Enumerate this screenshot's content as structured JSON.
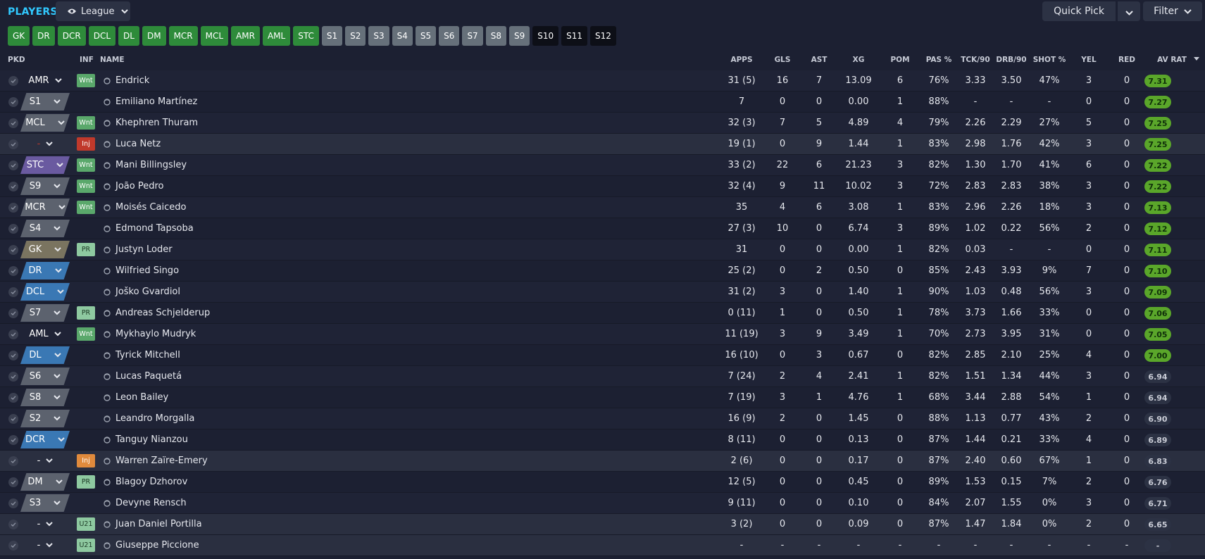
{
  "header": {
    "title": "PLAYERS",
    "view_label": "League",
    "quick_pick_label": "Quick Pick",
    "filter_label": "Filter"
  },
  "position_filters": [
    {
      "label": "GK",
      "style": "green"
    },
    {
      "label": "DR",
      "style": "green"
    },
    {
      "label": "DCR",
      "style": "green"
    },
    {
      "label": "DCL",
      "style": "green"
    },
    {
      "label": "DL",
      "style": "green"
    },
    {
      "label": "DM",
      "style": "green"
    },
    {
      "label": "MCR",
      "style": "green"
    },
    {
      "label": "MCL",
      "style": "green"
    },
    {
      "label": "AMR",
      "style": "green"
    },
    {
      "label": "AML",
      "style": "green"
    },
    {
      "label": "STC",
      "style": "green"
    },
    {
      "label": "S1",
      "style": "grey"
    },
    {
      "label": "S2",
      "style": "grey"
    },
    {
      "label": "S3",
      "style": "grey"
    },
    {
      "label": "S4",
      "style": "grey"
    },
    {
      "label": "S5",
      "style": "grey"
    },
    {
      "label": "S6",
      "style": "grey"
    },
    {
      "label": "S7",
      "style": "grey"
    },
    {
      "label": "S8",
      "style": "grey"
    },
    {
      "label": "S9",
      "style": "grey"
    },
    {
      "label": "S10",
      "style": "dark"
    },
    {
      "label": "S11",
      "style": "dark"
    },
    {
      "label": "S12",
      "style": "dark"
    }
  ],
  "columns": {
    "pkd": "PKD",
    "inf": "INF",
    "name": "NAME",
    "apps": "APPS",
    "gls": "GLS",
    "ast": "AST",
    "xg": "XG",
    "pom": "POM",
    "pas": "PAS %",
    "tck": "TCK/90",
    "drb": "DRB/90",
    "shot": "SHOT %",
    "yel": "YEL",
    "red": "RED",
    "avrat": "AV RAT"
  },
  "colors": {
    "accent_title": "#31c9ff",
    "pos_selected": "#1c2032",
    "pos_sub": "#5c626e",
    "pos_def": "#3a78b4",
    "pos_st": "#6a5aa0",
    "pos_gk": "#7a7460"
  },
  "players": [
    {
      "pos": "AMR",
      "pos_type": "sel",
      "inf": "Wnt",
      "name": "Endrick",
      "apps": "31 (5)",
      "gls": "16",
      "ast": "7",
      "xg": "13.09",
      "pom": "6",
      "pas": "76%",
      "tck": "3.33",
      "drb": "3.50",
      "shot": "47%",
      "yel": "3",
      "red": "0",
      "rat": "7.31",
      "hl": false
    },
    {
      "pos": "S1",
      "pos_type": "sub",
      "inf": "",
      "name": "Emiliano Martínez",
      "apps": "7",
      "gls": "0",
      "ast": "0",
      "xg": "0.00",
      "pom": "1",
      "pas": "88%",
      "tck": "-",
      "drb": "-",
      "shot": "-",
      "yel": "0",
      "red": "0",
      "rat": "7.27",
      "hl": false
    },
    {
      "pos": "MCL",
      "pos_type": "sub",
      "inf": "Wnt",
      "name": "Khephren Thuram",
      "apps": "32 (3)",
      "gls": "7",
      "ast": "5",
      "xg": "4.89",
      "pom": "4",
      "pas": "79%",
      "tck": "2.26",
      "drb": "2.29",
      "shot": "27%",
      "yel": "5",
      "red": "0",
      "rat": "7.25",
      "hl": false
    },
    {
      "pos": "-",
      "pos_type": "selred",
      "inf": "Inj",
      "name": "Luca Netz",
      "apps": "19 (1)",
      "gls": "0",
      "ast": "9",
      "xg": "1.44",
      "pom": "1",
      "pas": "83%",
      "tck": "2.98",
      "drb": "1.76",
      "shot": "42%",
      "yel": "3",
      "red": "0",
      "rat": "7.25",
      "hl": true
    },
    {
      "pos": "STC",
      "pos_type": "st",
      "inf": "Wnt",
      "name": "Mani Billingsley",
      "apps": "33 (2)",
      "gls": "22",
      "ast": "6",
      "xg": "21.23",
      "pom": "3",
      "pas": "82%",
      "tck": "1.30",
      "drb": "1.70",
      "shot": "41%",
      "yel": "6",
      "red": "0",
      "rat": "7.22",
      "hl": false
    },
    {
      "pos": "S9",
      "pos_type": "sub",
      "inf": "Wnt",
      "name": "João Pedro",
      "apps": "32 (4)",
      "gls": "9",
      "ast": "11",
      "xg": "10.02",
      "pom": "3",
      "pas": "72%",
      "tck": "2.83",
      "drb": "2.83",
      "shot": "38%",
      "yel": "3",
      "red": "0",
      "rat": "7.22",
      "hl": false
    },
    {
      "pos": "MCR",
      "pos_type": "sub",
      "inf": "Wnt",
      "name": "Moisés Caicedo",
      "apps": "35",
      "gls": "4",
      "ast": "6",
      "xg": "3.08",
      "pom": "1",
      "pas": "83%",
      "tck": "2.96",
      "drb": "2.26",
      "shot": "18%",
      "yel": "3",
      "red": "0",
      "rat": "7.13",
      "hl": false
    },
    {
      "pos": "S4",
      "pos_type": "sub",
      "inf": "",
      "name": "Edmond Tapsoba",
      "apps": "27 (3)",
      "gls": "10",
      "ast": "0",
      "xg": "6.74",
      "pom": "3",
      "pas": "89%",
      "tck": "1.02",
      "drb": "0.22",
      "shot": "56%",
      "yel": "2",
      "red": "0",
      "rat": "7.12",
      "hl": false
    },
    {
      "pos": "GK",
      "pos_type": "gk",
      "inf": "PR",
      "name": "Justyn Loder",
      "apps": "31",
      "gls": "0",
      "ast": "0",
      "xg": "0.00",
      "pom": "1",
      "pas": "82%",
      "tck": "0.03",
      "drb": "-",
      "shot": "-",
      "yel": "0",
      "red": "0",
      "rat": "7.11",
      "hl": false
    },
    {
      "pos": "DR",
      "pos_type": "def",
      "inf": "",
      "name": "Wilfried Singo",
      "apps": "25 (2)",
      "gls": "0",
      "ast": "2",
      "xg": "0.50",
      "pom": "0",
      "pas": "85%",
      "tck": "2.43",
      "drb": "3.93",
      "shot": "9%",
      "yel": "7",
      "red": "0",
      "rat": "7.10",
      "hl": false
    },
    {
      "pos": "DCL",
      "pos_type": "def",
      "inf": "",
      "name": "Joško Gvardiol",
      "apps": "31 (2)",
      "gls": "3",
      "ast": "0",
      "xg": "1.40",
      "pom": "1",
      "pas": "90%",
      "tck": "1.03",
      "drb": "0.48",
      "shot": "56%",
      "yel": "3",
      "red": "0",
      "rat": "7.09",
      "hl": false
    },
    {
      "pos": "S7",
      "pos_type": "sub",
      "inf": "PR",
      "name": "Andreas Schjelderup",
      "apps": "0 (11)",
      "gls": "1",
      "ast": "0",
      "xg": "0.50",
      "pom": "1",
      "pas": "78%",
      "tck": "3.73",
      "drb": "1.66",
      "shot": "33%",
      "yel": "0",
      "red": "0",
      "rat": "7.06",
      "hl": false
    },
    {
      "pos": "AML",
      "pos_type": "sel",
      "inf": "Wnt",
      "name": "Mykhaylo Mudryk",
      "apps": "11 (19)",
      "gls": "3",
      "ast": "9",
      "xg": "3.49",
      "pom": "1",
      "pas": "70%",
      "tck": "2.73",
      "drb": "3.95",
      "shot": "31%",
      "yel": "0",
      "red": "0",
      "rat": "7.05",
      "hl": false
    },
    {
      "pos": "DL",
      "pos_type": "def",
      "inf": "",
      "name": "Tyrick Mitchell",
      "apps": "16 (10)",
      "gls": "0",
      "ast": "3",
      "xg": "0.67",
      "pom": "0",
      "pas": "82%",
      "tck": "2.85",
      "drb": "2.10",
      "shot": "25%",
      "yel": "4",
      "red": "0",
      "rat": "7.00",
      "hl": false
    },
    {
      "pos": "S6",
      "pos_type": "sub",
      "inf": "",
      "name": "Lucas Paquetá",
      "apps": "7 (24)",
      "gls": "2",
      "ast": "4",
      "xg": "2.41",
      "pom": "1",
      "pas": "82%",
      "tck": "1.51",
      "drb": "1.34",
      "shot": "44%",
      "yel": "3",
      "red": "0",
      "rat": "6.94",
      "hl": false
    },
    {
      "pos": "S8",
      "pos_type": "sub",
      "inf": "",
      "name": "Leon Bailey",
      "apps": "7 (19)",
      "gls": "3",
      "ast": "1",
      "xg": "4.76",
      "pom": "1",
      "pas": "68%",
      "tck": "3.44",
      "drb": "2.88",
      "shot": "54%",
      "yel": "1",
      "red": "0",
      "rat": "6.94",
      "hl": false
    },
    {
      "pos": "S2",
      "pos_type": "sub",
      "inf": "",
      "name": "Leandro Morgalla",
      "apps": "16 (9)",
      "gls": "2",
      "ast": "0",
      "xg": "1.45",
      "pom": "0",
      "pas": "88%",
      "tck": "1.13",
      "drb": "0.77",
      "shot": "43%",
      "yel": "2",
      "red": "0",
      "rat": "6.90",
      "hl": false
    },
    {
      "pos": "DCR",
      "pos_type": "def",
      "inf": "",
      "name": "Tanguy Nianzou",
      "apps": "8 (11)",
      "gls": "0",
      "ast": "0",
      "xg": "0.13",
      "pom": "0",
      "pas": "87%",
      "tck": "1.44",
      "drb": "0.21",
      "shot": "33%",
      "yel": "4",
      "red": "0",
      "rat": "6.89",
      "hl": false
    },
    {
      "pos": "-",
      "pos_type": "sel",
      "inf": "Inj",
      "inf_style": "injo",
      "name": "Warren Zaïre-Emery",
      "apps": "2 (6)",
      "gls": "0",
      "ast": "0",
      "xg": "0.17",
      "pom": "0",
      "pas": "87%",
      "tck": "2.40",
      "drb": "0.60",
      "shot": "67%",
      "yel": "1",
      "red": "0",
      "rat": "6.83",
      "hl": true
    },
    {
      "pos": "DM",
      "pos_type": "sub",
      "inf": "PR",
      "name": "Blagoy Dzhorov",
      "apps": "12 (5)",
      "gls": "0",
      "ast": "0",
      "xg": "0.45",
      "pom": "0",
      "pas": "89%",
      "tck": "1.53",
      "drb": "0.15",
      "shot": "7%",
      "yel": "2",
      "red": "0",
      "rat": "6.76",
      "hl": false
    },
    {
      "pos": "S3",
      "pos_type": "sub",
      "inf": "",
      "name": "Devyne Rensch",
      "apps": "9 (11)",
      "gls": "0",
      "ast": "0",
      "xg": "0.10",
      "pom": "0",
      "pas": "84%",
      "tck": "2.07",
      "drb": "1.55",
      "shot": "0%",
      "yel": "3",
      "red": "0",
      "rat": "6.71",
      "hl": false
    },
    {
      "pos": "-",
      "pos_type": "sel",
      "inf": "U21",
      "name": "Juan Daniel Portilla",
      "apps": "3 (2)",
      "gls": "0",
      "ast": "0",
      "xg": "0.09",
      "pom": "0",
      "pas": "87%",
      "tck": "1.47",
      "drb": "1.84",
      "shot": "0%",
      "yel": "2",
      "red": "0",
      "rat": "6.65",
      "hl": true
    },
    {
      "pos": "-",
      "pos_type": "sel",
      "inf": "U21",
      "name": "Giuseppe Piccione",
      "apps": "-",
      "gls": "-",
      "ast": "-",
      "xg": "-",
      "pom": "-",
      "pas": "-",
      "tck": "-",
      "drb": "-",
      "shot": "-",
      "yel": "-",
      "red": "-",
      "rat": "-",
      "hl": true
    }
  ]
}
